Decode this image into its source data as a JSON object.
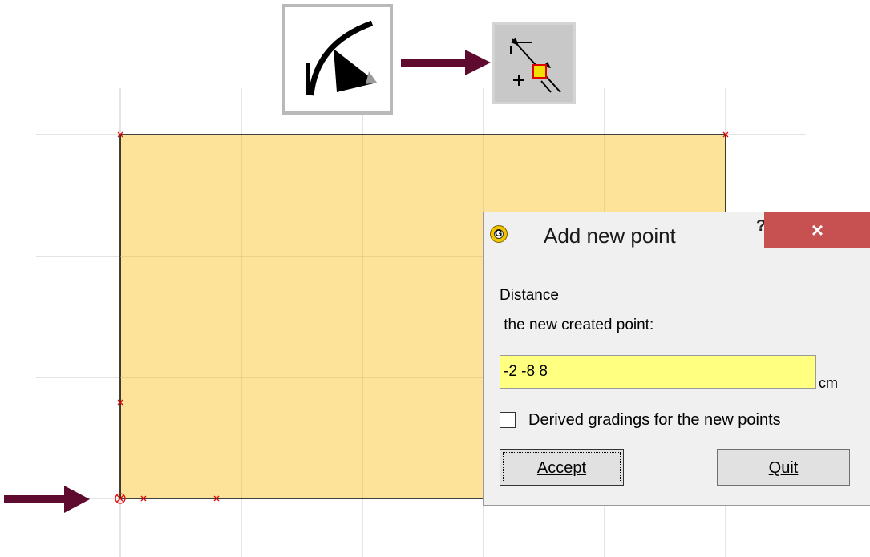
{
  "dialog": {
    "title": "Add new point",
    "help_label": "?",
    "close_label": "×",
    "app_icon_letter": "G",
    "distance_label": "Distance",
    "distance_sublabel": " the new created point:",
    "distance_value": "-2 -8 8",
    "unit_label": "cm",
    "derived_checkbox_label": "Derived gradings for the new points",
    "derived_checked": false,
    "accept_label": "Accept",
    "quit_label": "Quit"
  },
  "tools": {
    "arc_tool_icon": "arc-tool-icon",
    "add-point-tool-icon": "add-point-tool-icon"
  },
  "colors": {
    "piece_fill": "#fde39a",
    "annotation_arrow": "#5e0b2f",
    "input_background": "#ffff80",
    "close_button": "#c75050",
    "point_marker": "#e01010"
  }
}
